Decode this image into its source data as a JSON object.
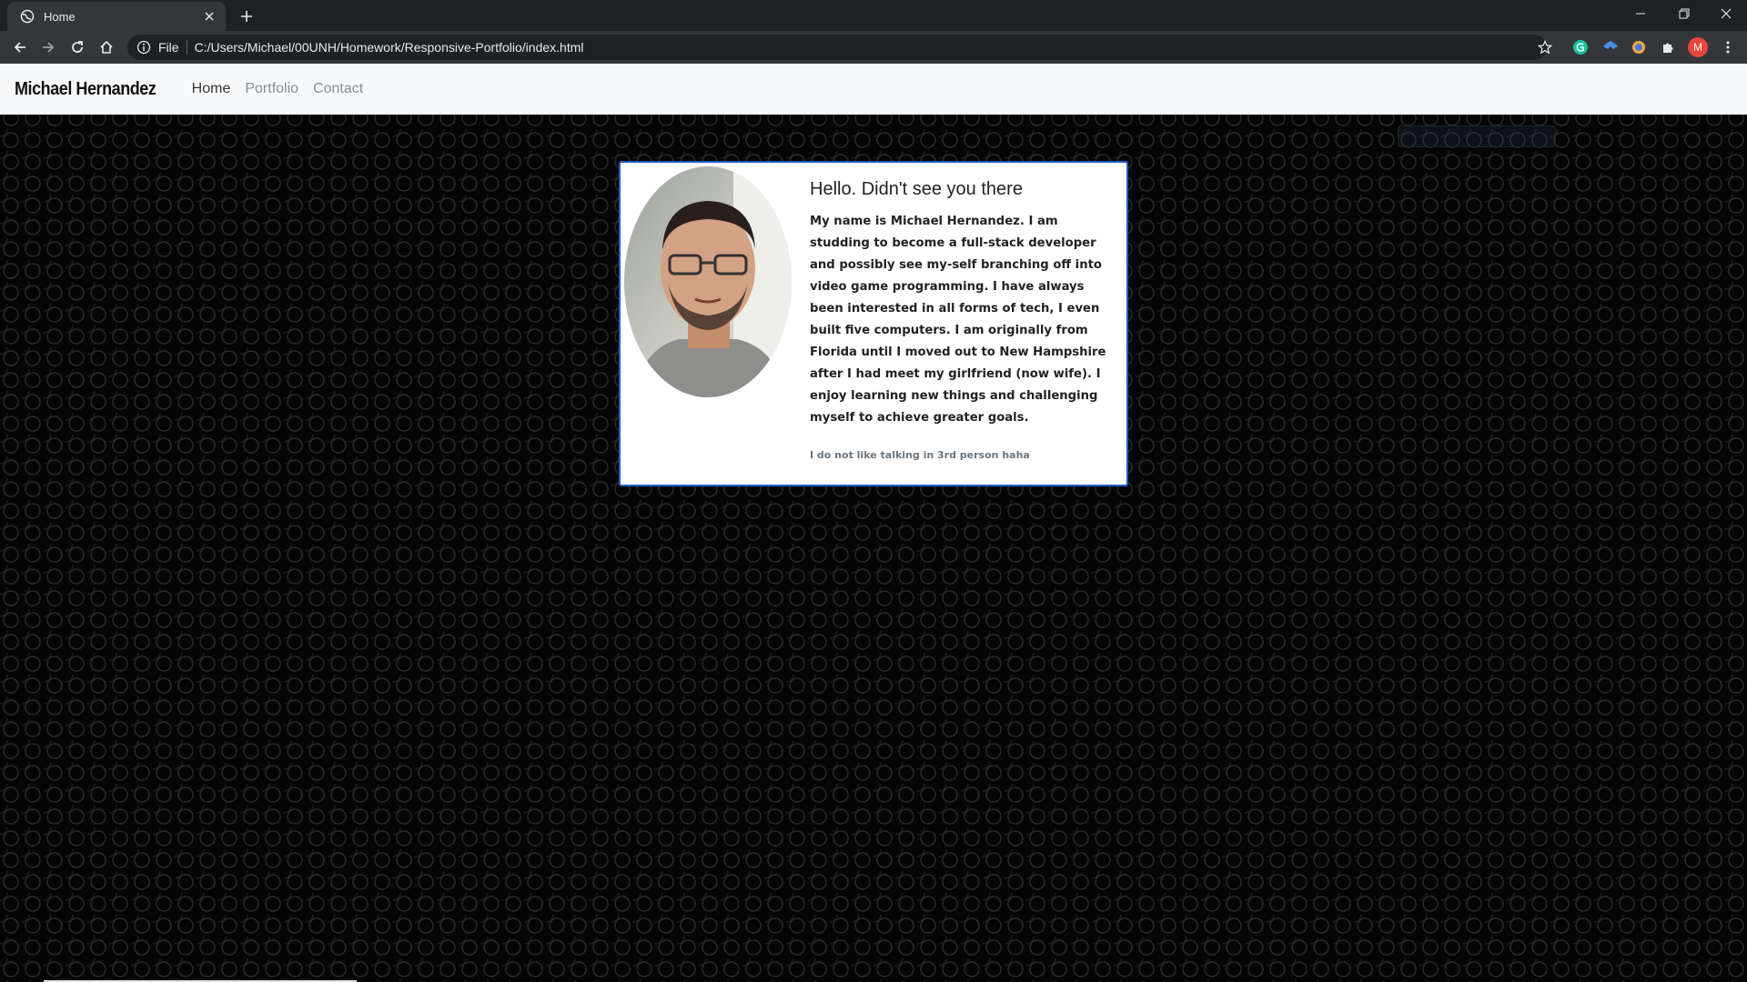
{
  "browser": {
    "tab_title": "Home",
    "url_scheme": "File",
    "url": "C:/Users/Michael/00UNH/Homework/Responsive-Portfolio/index.html",
    "profile_initial": "M"
  },
  "site": {
    "brand": "Michael Hernandez",
    "nav": [
      {
        "label": "Home",
        "active": true
      },
      {
        "label": "Portfolio",
        "active": false
      },
      {
        "label": "Contact",
        "active": false
      }
    ]
  },
  "card": {
    "title": "Hello. Didn't see you there",
    "text": "My name is Michael Hernandez. I am studding to become a full-stack developer and possibly see my-self branching off into video game programming. I have always been interested in all forms of tech, I even built five computers. I am originally from Florida until I moved out to New Hampshire after I had meet my girlfriend (now wife). I enjoy learning new things and challenging myself to achieve greater goals.",
    "note": "I do not like talking in 3rd person haha"
  },
  "colors": {
    "card_border": "#1f5fbf",
    "nav_bg": "#f8f9fa",
    "chrome_dark": "#202124",
    "chrome_toolbar": "#35363a"
  }
}
